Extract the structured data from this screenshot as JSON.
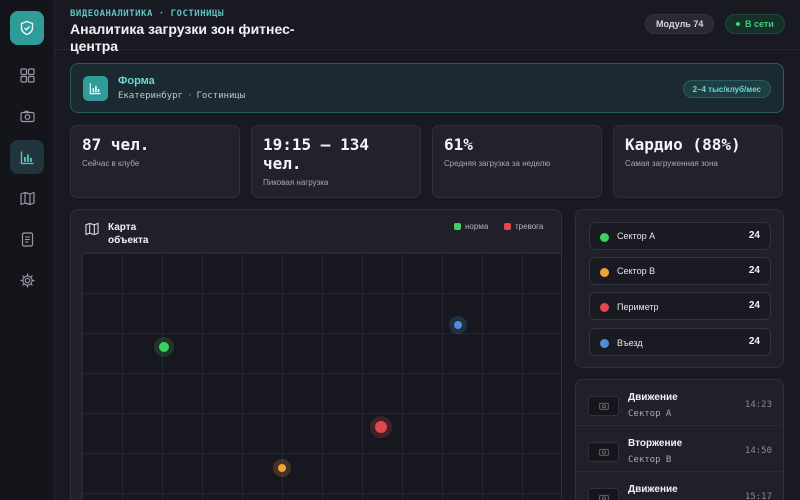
{
  "app": {
    "eyebrow": "ВИДЕОАНАЛИТИКА · ГОСТИНИЦЫ",
    "title": "Аналитика загрузки зон фитнес-центра",
    "module_badge": "Модуль 74",
    "status_badge": "В сети"
  },
  "sidebar": {
    "logo_icon": "shield-check-icon",
    "items": [
      {
        "icon": "dashboard-grid-icon",
        "active": false
      },
      {
        "icon": "camera-icon",
        "active": false
      },
      {
        "icon": "bar-chart-icon",
        "active": true
      },
      {
        "icon": "map-icon",
        "active": false
      },
      {
        "icon": "document-icon",
        "active": false
      },
      {
        "icon": "gear-icon",
        "active": false
      }
    ]
  },
  "banner": {
    "icon": "bar-chart-icon",
    "title": "Форма",
    "city": "Екатеринбург",
    "separator": "·",
    "category": "Гостиницы",
    "chip": "2–4 тыс/клуб/мес"
  },
  "stats": [
    {
      "value": "87 чел.",
      "label": "Сейчас в клубе"
    },
    {
      "value": "19:15 — 134 чел.",
      "label": "Пиковая нагрузка"
    },
    {
      "value": "61%",
      "label": "Средняя загрузка за неделю"
    },
    {
      "value": "Кардио (88%)",
      "label": "Самая загруженная зона"
    }
  ],
  "map": {
    "title": "Карта объекта",
    "legend": [
      {
        "label": "норма",
        "color": "#3ecf5f"
      },
      {
        "label": "тревога",
        "color": "#e0484d"
      }
    ],
    "markers": [
      {
        "sector": "Сектор А",
        "color": "#3ecf5f"
      },
      {
        "sector": "Въезд",
        "color": "#4f8fd6"
      },
      {
        "sector": "Периметр",
        "color": "#e0484d"
      },
      {
        "sector": "Сектор В",
        "color": "#f0a23a"
      }
    ]
  },
  "sectors": [
    {
      "name": "Сектор А",
      "count": "24",
      "color": "#3ecf5f"
    },
    {
      "name": "Сектор В",
      "count": "24",
      "color": "#f0a23a"
    },
    {
      "name": "Периметр",
      "count": "24",
      "color": "#e0484d"
    },
    {
      "name": "Въезд",
      "count": "24",
      "color": "#4f8fd6"
    }
  ],
  "events": [
    {
      "title": "Движение",
      "sector": "Сектор А",
      "time": "14:23"
    },
    {
      "title": "Вторжение",
      "sector": "Сектор В",
      "time": "14:50"
    },
    {
      "title": "Движение",
      "sector": "",
      "time": "15:17"
    }
  ],
  "colors": {
    "accent": "#2f9c9a",
    "online": "#3ecf7a"
  }
}
